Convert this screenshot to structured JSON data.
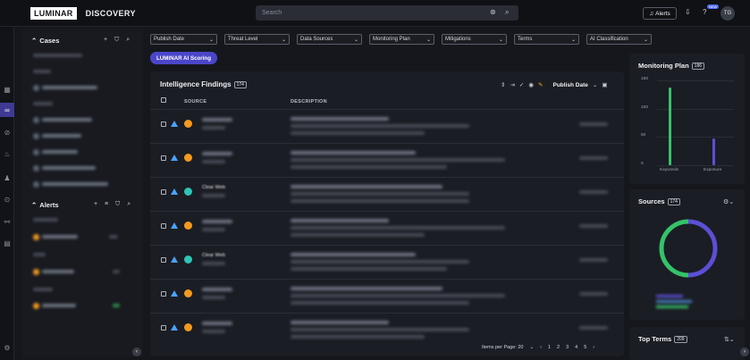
{
  "app": {
    "logo": "LUMINAR",
    "product": "DISCOVERY"
  },
  "topbar": {
    "search_placeholder": "Search",
    "alerts_label": "Alerts",
    "new_badge": "NEW",
    "avatar_initials": "TG"
  },
  "left_panel": {
    "cases_title": "Cases",
    "cases_tools": "+ ⛉ ⌕",
    "alerts_title": "Alerts",
    "alerts_tools": "+ ≡ ⛉ ⌕"
  },
  "filters": [
    {
      "label": "Publish Date"
    },
    {
      "label": "Threat Level"
    },
    {
      "label": "Data Sources"
    },
    {
      "label": "Monitoring Plan"
    },
    {
      "label": "Mitigations"
    },
    {
      "label": "Terms"
    },
    {
      "label": "AI Classification"
    }
  ],
  "scoring_pill": "LUMINAR AI Scoring",
  "findings": {
    "title": "Intelligence Findings",
    "count": "174",
    "sort_label": "Publish Date",
    "col_source": "SOURCE",
    "col_description": "DESCRIPTION",
    "rows": [
      {
        "source_color": "#f39a1f"
      },
      {
        "source_color": "#f39a1f"
      },
      {
        "source_color": "#2ec4b6",
        "title": "Clear Web"
      },
      {
        "source_color": "#f39a1f"
      },
      {
        "source_color": "#2ec4b6",
        "title": "Clear Web"
      },
      {
        "source_color": "#f39a1f"
      },
      {
        "source_color": "#f39a1f"
      }
    ],
    "pager": {
      "items_per_page_label": "Items per Page: 20",
      "pages": [
        "1",
        "2",
        "3",
        "4",
        "5"
      ],
      "current": "1"
    }
  },
  "monitoring_plan": {
    "title": "Monitoring Plan",
    "count": "186",
    "chart_data": {
      "type": "bar",
      "categories": [
        "Keywords",
        "Exposure"
      ],
      "values": [
        137,
        48
      ],
      "yticks": [
        0,
        50,
        100,
        150
      ],
      "ylim": [
        0,
        150
      ],
      "colors": [
        "#34c26a",
        "#5b4fd6"
      ]
    }
  },
  "sources": {
    "title": "Sources",
    "count": "174",
    "chart_data": {
      "type": "pie",
      "segments": [
        {
          "value": 0.5,
          "color": "#5b4fd6"
        },
        {
          "value": 0.5,
          "color": "#34c26a"
        }
      ]
    }
  },
  "top_terms": {
    "title": "Top Terms",
    "count": "209"
  }
}
